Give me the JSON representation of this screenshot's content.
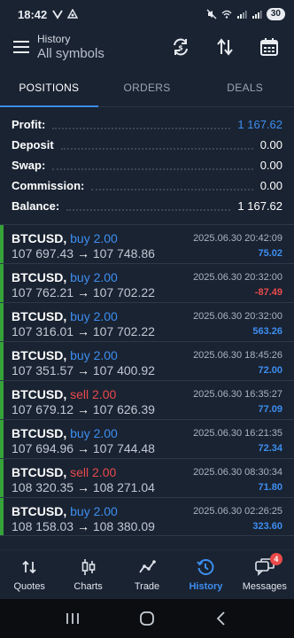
{
  "status_bar": {
    "time": "18:42",
    "battery": "30"
  },
  "header": {
    "title": "History",
    "subtitle": "All symbols"
  },
  "tabs": [
    {
      "label": "POSITIONS",
      "active": true
    },
    {
      "label": "ORDERS",
      "active": false
    },
    {
      "label": "DEALS",
      "active": false
    }
  ],
  "summary": {
    "profit_label": "Profit:",
    "profit_value": "1 167.62",
    "deposit_label": "Deposit",
    "deposit_value": "0.00",
    "swap_label": "Swap:",
    "swap_value": "0.00",
    "commission_label": "Commission:",
    "commission_value": "0.00",
    "balance_label": "Balance:",
    "balance_value": "1 167.62"
  },
  "positions": [
    {
      "symbol": "BTCUSD,",
      "side": "buy 2.00",
      "open": "107 697.43",
      "arrow": "→",
      "close": "107 748.86",
      "time": "2025.06.30 20:42:09",
      "profit": "75.02"
    },
    {
      "symbol": "BTCUSD,",
      "side": "buy 2.00",
      "open": "107 762.21",
      "arrow": "→",
      "close": "107 702.22",
      "time": "2025.06.30 20:32:00",
      "profit": "-87.49"
    },
    {
      "symbol": "BTCUSD,",
      "side": "buy 2.00",
      "open": "107 316.01",
      "arrow": "→",
      "close": "107 702.22",
      "time": "2025.06.30 20:32:00",
      "profit": "563.26"
    },
    {
      "symbol": "BTCUSD,",
      "side": "buy 2.00",
      "open": "107 351.57",
      "arrow": "→",
      "close": "107 400.92",
      "time": "2025.06.30 18:45:26",
      "profit": "72.00"
    },
    {
      "symbol": "BTCUSD,",
      "side": "sell 2.00",
      "open": "107 679.12",
      "arrow": "→",
      "close": "107 626.39",
      "time": "2025.06.30 16:35:27",
      "profit": "77.09"
    },
    {
      "symbol": "BTCUSD,",
      "side": "buy 2.00",
      "open": "107 694.96",
      "arrow": "→",
      "close": "107 744.48",
      "time": "2025.06.30 16:21:35",
      "profit": "72.34"
    },
    {
      "symbol": "BTCUSD,",
      "side": "sell 2.00",
      "open": "108 320.35",
      "arrow": "→",
      "close": "108 271.04",
      "time": "2025.06.30 08:30:34",
      "profit": "71.80"
    },
    {
      "symbol": "BTCUSD,",
      "side": "buy 2.00",
      "open": "108 158.03",
      "arrow": "→",
      "close": "108 380.09",
      "time": "2025.06.30 02:26:25",
      "profit": "323.60"
    }
  ],
  "bottom_nav": [
    {
      "label": "Quotes",
      "icon": "quotes-icon"
    },
    {
      "label": "Charts",
      "icon": "candlestick-chart-icon"
    },
    {
      "label": "Trade",
      "icon": "trade-icon"
    },
    {
      "label": "History",
      "icon": "history-icon",
      "active": true
    },
    {
      "label": "Messages",
      "icon": "messages-icon",
      "badge": "4"
    }
  ],
  "colors": {
    "accent": "#3d8ef0",
    "loss": "#e94a4a",
    "position_bar": "#36a33a",
    "background": "#1a2332"
  }
}
